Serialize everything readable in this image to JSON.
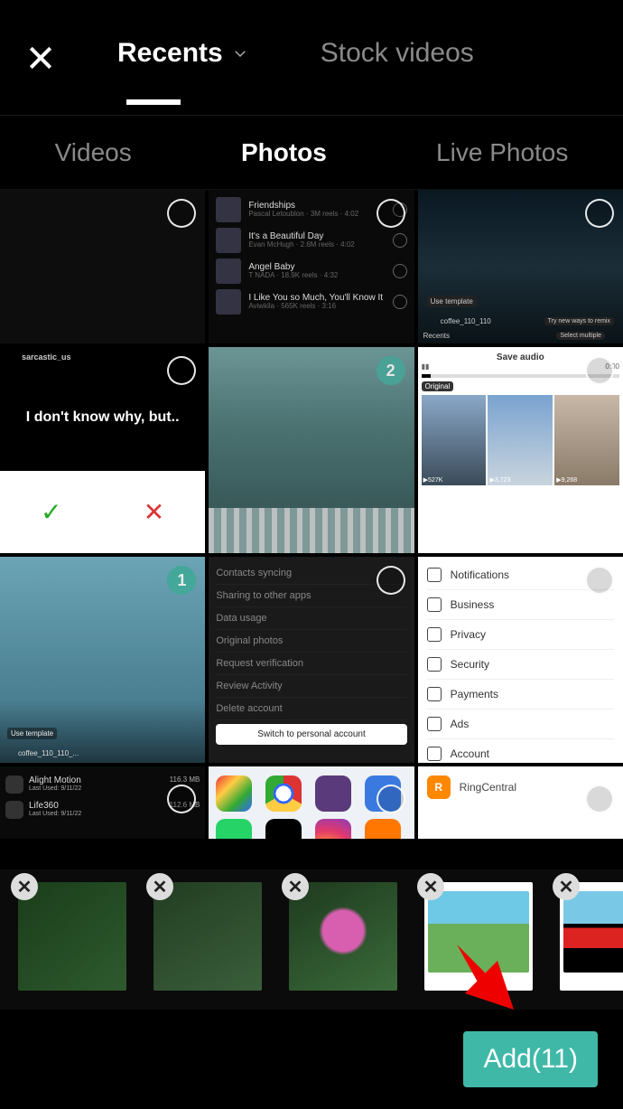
{
  "header": {
    "top_tabs": {
      "recents": "Recents",
      "stock": "Stock videos"
    },
    "sub_tabs": {
      "videos": "Videos",
      "photos": "Photos",
      "live": "Live Photos"
    }
  },
  "music_list": [
    {
      "title": "Friendships",
      "sub": "Pascal Letoublon · 3M reels · 4:02"
    },
    {
      "title": "It's a Beautiful Day",
      "sub": "Evan McHugh · 2.6M reels · 4:02"
    },
    {
      "title": "Angel Baby",
      "sub": "T NADA · 18.9K reels · 4:32"
    },
    {
      "title": "I Like You so Much, You'll Know It",
      "sub": "Aviwkila · 565K reels · 3:16"
    }
  ],
  "bridge_thumb": {
    "user": "coffee_110_110",
    "hint": "Try new ways to remix",
    "use_template": "Use template",
    "recents": "Recents",
    "select": "Select multiple"
  },
  "meme": {
    "user": "sarcastic_us",
    "caption": "I don't know why, but..",
    "check": "✓",
    "x": "✕"
  },
  "save_audio": {
    "label": "Save audio",
    "original": "Original",
    "time": "0:00",
    "views": [
      "527K",
      "3,723",
      "9,268"
    ]
  },
  "sky_thumb": {
    "use_template": "Use template",
    "user": "coffee_110_110_..."
  },
  "settings_dark": [
    "Contacts syncing",
    "Sharing to other apps",
    "Data usage",
    "Original photos",
    "Request verification",
    "Review Activity",
    "Delete account"
  ],
  "settings_dark_btn": "Switch to personal account",
  "settings_light": [
    "Notifications",
    "Business",
    "Privacy",
    "Security",
    "Payments",
    "Ads",
    "Account"
  ],
  "apps_dark": [
    {
      "name": "Alight Motion",
      "sub": "Last Used: 9/11/22",
      "size": "116.3 MB"
    },
    {
      "name": "Life360",
      "sub": "Last Used: 9/11/22",
      "size": "112.6 MB"
    }
  ],
  "ringcentral": "RingCentral",
  "selected_badges": {
    "one": "1",
    "two": "2"
  },
  "add_button": {
    "label": "Add(11)"
  }
}
